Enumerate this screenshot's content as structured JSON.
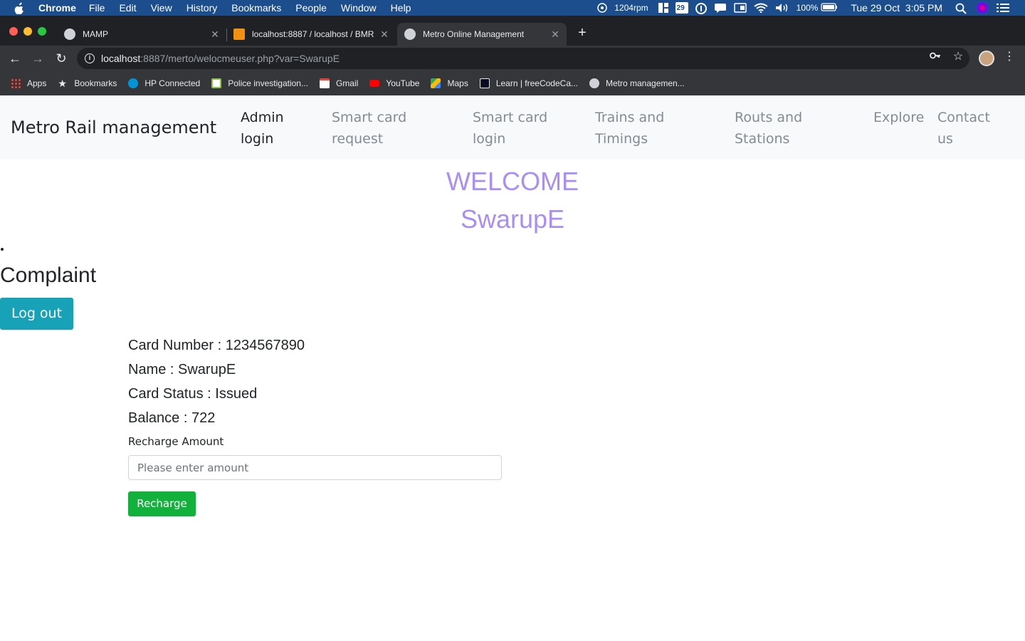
{
  "menubar": {
    "app": "Chrome",
    "items": [
      "File",
      "Edit",
      "View",
      "History",
      "Bookmarks",
      "People",
      "Window",
      "Help"
    ],
    "fan": "1204rpm",
    "calendar_day": "29",
    "battery": "100%",
    "clock": "Tue 29 Oct  3:05 PM"
  },
  "browser": {
    "tabs": [
      {
        "title": "MAMP"
      },
      {
        "title": "localhost:8887 / localhost / BMR"
      },
      {
        "title": "Metro Online Management"
      }
    ],
    "url_host": "localhost",
    "url_rest": ":8887/merto/welocmeuser.php?var=SwarupE",
    "bookmarks": [
      "Apps",
      "Bookmarks",
      "HP Connected",
      "Police investigation...",
      "Gmail",
      "YouTube",
      "Maps",
      "Learn | freeCodeCa...",
      "Metro managemen..."
    ]
  },
  "navbar": {
    "brand": "Metro Rail management",
    "links": [
      {
        "line1": "Admin",
        "line2": "login"
      },
      {
        "line1": "Smart card",
        "line2": "request"
      },
      {
        "line1": "Smart card",
        "line2": "login"
      },
      {
        "line1": "Trains and",
        "line2": "Timings"
      },
      {
        "line1": "Routs and",
        "line2": "Stations"
      },
      {
        "line1": "Explore",
        "line2": ""
      },
      {
        "line1": "Contact",
        "line2": "us"
      }
    ]
  },
  "main": {
    "welcome": "WELCOME",
    "username": "SwarupE",
    "complaint": "Complaint",
    "logout_label": "Log out",
    "card_number": "Card Number : 1234567890",
    "name": "Name : SwarupE",
    "card_status": "Card Status : Issued",
    "balance": "Balance : 722",
    "recharge_label": "Recharge Amount",
    "amount_placeholder": "Please enter amount",
    "recharge_button": "Recharge"
  },
  "colors": {
    "menubar": "#1c4d8c",
    "welcome_text": "#a98ef5",
    "logout_button": "#17a2b8",
    "recharge_button": "#12b13b",
    "navbar_bg": "#f8f9fa"
  },
  "icons": [
    "apple-icon",
    "fan-icon",
    "calendar-icon",
    "wifi-icon",
    "volume-icon",
    "battery-icon",
    "search-icon",
    "siri-icon",
    "list-icon",
    "back-icon",
    "forward-icon",
    "reload-icon",
    "info-icon",
    "key-icon",
    "star-icon",
    "more-icon"
  ]
}
